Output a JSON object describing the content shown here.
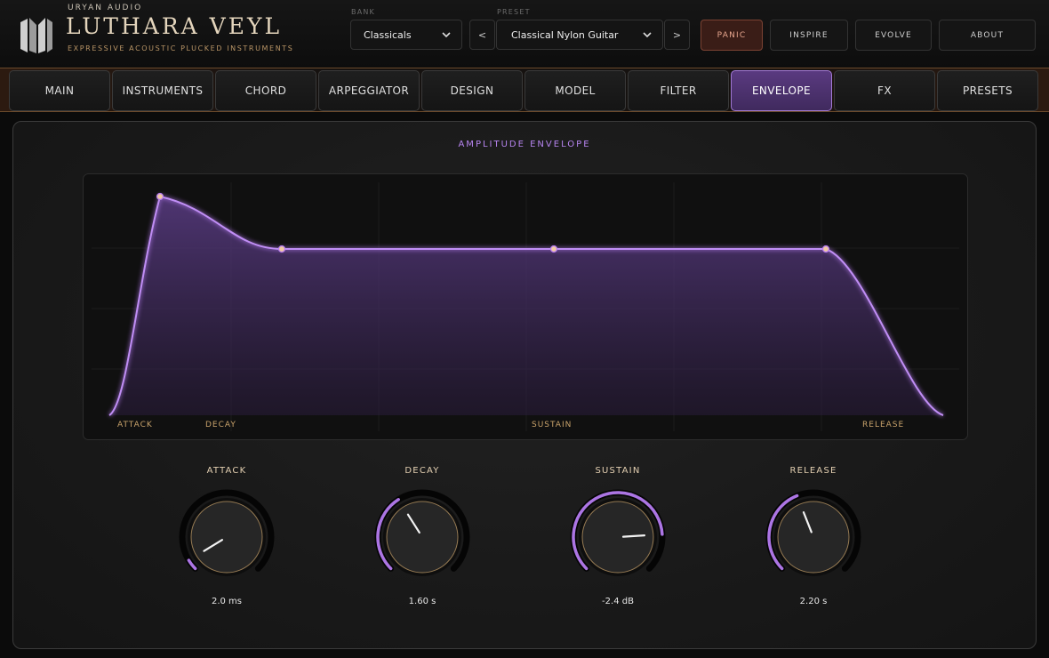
{
  "header": {
    "company": "URYAN AUDIO",
    "product": "LUTHARA VEYL",
    "tagline": "EXPRESSIVE ACOUSTIC PLUCKED INSTRUMENTS",
    "bank_label": "BANK",
    "bank_value": "Classicals",
    "preset_label": "PRESET",
    "preset_value": "Classical Nylon Guitar",
    "prev_label": "<",
    "next_label": ">",
    "buttons": {
      "panic": "PANIC",
      "inspire": "INSPIRE",
      "evolve": "EVOLVE",
      "about": "ABOUT"
    }
  },
  "tabs": [
    {
      "label": "MAIN"
    },
    {
      "label": "INSTRUMENTS"
    },
    {
      "label": "CHORD"
    },
    {
      "label": "ARPEGGIATOR"
    },
    {
      "label": "DESIGN"
    },
    {
      "label": "MODEL"
    },
    {
      "label": "FILTER"
    },
    {
      "label": "ENVELOPE",
      "active": true
    },
    {
      "label": "FX"
    },
    {
      "label": "PRESETS"
    }
  ],
  "envelope": {
    "title": "AMPLITUDE ENVELOPE",
    "stage_labels": {
      "attack": "ATTACK",
      "decay": "DECAY",
      "sustain": "SUSTAIN",
      "release": "RELEASE"
    },
    "knobs": {
      "attack": {
        "label": "ATTACK",
        "value": "2.0 ms",
        "level": 0.05
      },
      "decay": {
        "label": "DECAY",
        "value": "1.60 s",
        "level": 0.38
      },
      "sustain": {
        "label": "SUSTAIN",
        "value": "-2.4 dB",
        "level": 0.82
      },
      "release": {
        "label": "RELEASE",
        "value": "2.20 s",
        "level": 0.42
      }
    }
  },
  "colors": {
    "accent": "#b57bf0",
    "gold": "#c9a36b",
    "panic": "#e6a58d",
    "active_tab": "#4d3370"
  }
}
